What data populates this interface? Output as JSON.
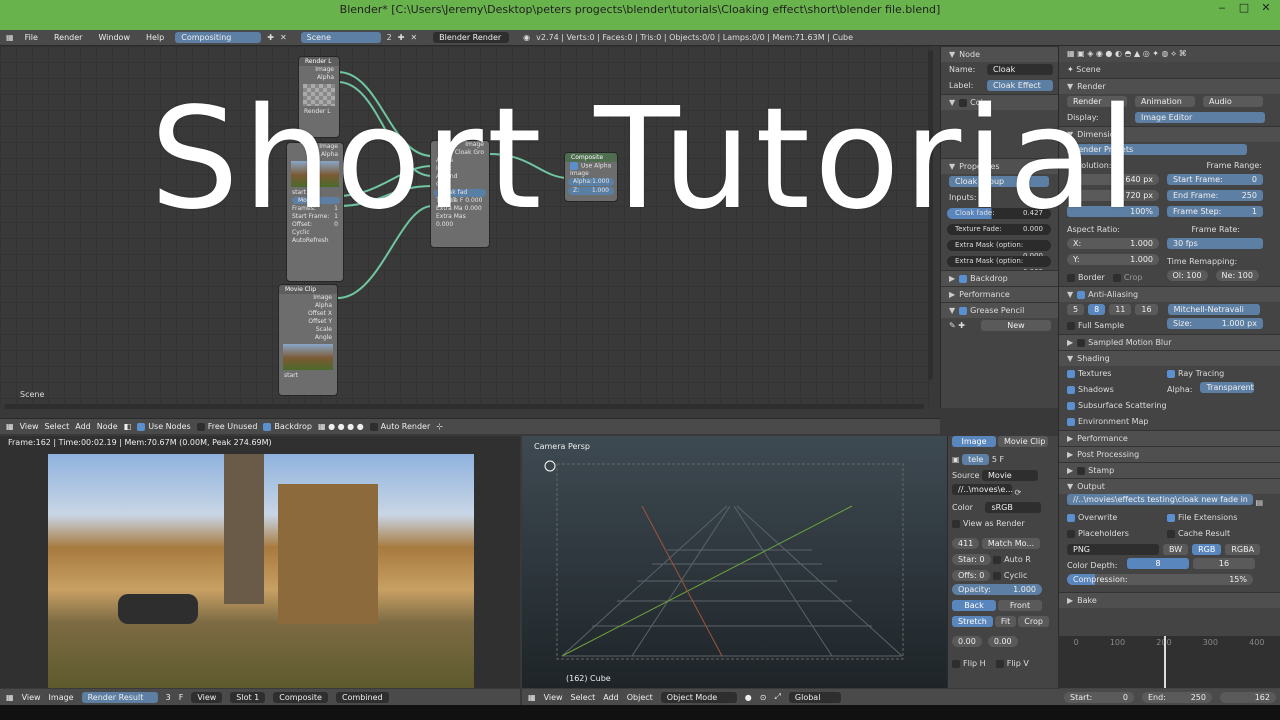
{
  "window": {
    "title": "Blender* [C:\\Users\\Jeremy\\Desktop\\peters progects\\blender\\tutorials\\Cloaking effect\\short\\blender file.blend]",
    "min": "‒",
    "max": "□",
    "close": "✕"
  },
  "topmenu": {
    "items": [
      "File",
      "Render",
      "Window",
      "Help"
    ],
    "layout": "Compositing",
    "scene": "Scene",
    "scene_num": "2",
    "engine": "Blender Render",
    "stats": "v2.74 | Verts:0 | Faces:0 | Tris:0 | Objects:0/0 | Lamps:0/0 | Mem:71.63M | Cube"
  },
  "overlay_text": "Short Tutorial",
  "node_editor": {
    "scene_label": "Scene",
    "nodes": {
      "render_layers": {
        "title": "Render L",
        "rows": [
          "Image",
          "Alpha"
        ],
        "bottom": "Render L"
      },
      "image_node": {
        "rows": [
          "Image",
          "Alpha"
        ],
        "file": "start",
        "num": "2",
        "f": "F",
        "source": "Movie",
        "frames": "Frames:",
        "frames_v": "1",
        "start": "Start Frame:",
        "start_v": "1",
        "offset": "Offset:",
        "offset_v": "0",
        "cyclic": "Cyclic",
        "auto": "AutoRefresh"
      },
      "movie_clip": {
        "title": "Movie Clip",
        "rows": [
          "Image",
          "Alpha",
          "Offset X",
          "Offset Y",
          "Scale",
          "Angle"
        ],
        "file": "start",
        "f": "F"
      },
      "cloak": {
        "rows": [
          "Image",
          "Cloak Gro",
          "Alpha",
          "Input",
          "Around",
          "Clip"
        ],
        "fade": "Cloak fad 0.427",
        "tex": "Texture F 0.000",
        "m1": "Extra Ma 0.000",
        "m2": "Extra Mas 0.000"
      },
      "composite": {
        "title": "Composite",
        "use_alpha": "Use Alpha",
        "rows": [
          "Image"
        ],
        "alpha": "Alpha:",
        "alpha_v": "1.000",
        "z": "Z:",
        "z_v": "1.000"
      }
    },
    "header": {
      "items": [
        "View",
        "Select",
        "Add",
        "Node"
      ],
      "use_nodes": "Use Nodes",
      "free_unused": "Free Unused",
      "backdrop": "Backdrop",
      "auto_render": "Auto Render"
    }
  },
  "n_panel": {
    "node_section": "Node",
    "name_label": "Name:",
    "name_value": "Cloak",
    "label_label": "Label:",
    "label_value": "Cloak Effect",
    "color_section": "Color",
    "properties_section": "Properties",
    "group": "Cloak Group",
    "inputs_label": "Inputs:",
    "inputs": [
      {
        "name": "Cloak fade:",
        "value": "0.427"
      },
      {
        "name": "Texture Fade:",
        "value": "0.000"
      },
      {
        "name": "Extra Mask (option:",
        "value": "0.000"
      },
      {
        "name": "Extra Mask (option:",
        "value": "0.000"
      }
    ],
    "backdrop": "Backdrop",
    "performance": "Performance",
    "grease": "Grease Pencil",
    "new": "New"
  },
  "properties": {
    "scene": "Scene",
    "render_section": "Render",
    "render_btn": "Render",
    "animation_btn": "Animation",
    "audio_btn": "Audio",
    "display_label": "Display:",
    "display_value": "Image Editor",
    "dimensions_section": "Dimensions",
    "render_presets": "Render Presets",
    "resolution": "Resolution:",
    "res_x": "640 px",
    "res_y_label": "Y:",
    "res_y": "720 px",
    "res_pct": "100%",
    "frame_range": "Frame Range:",
    "start_frame": "Start Frame:",
    "start_frame_v": "0",
    "end_frame": "End Frame:",
    "end_frame_v": "250",
    "frame_step": "Frame Step:",
    "frame_step_v": "1",
    "aspect": "Aspect Ratio:",
    "ax": "X:",
    "ax_v": "1.000",
    "ay": "Y:",
    "ay_v": "1.000",
    "frame_rate": "Frame Rate:",
    "fps": "30 fps",
    "time_remap": "Time Remapping:",
    "ol": "Ol: 100",
    "ne": "Ne: 100",
    "border": "Border",
    "crop": "Crop",
    "aa_section": "Anti-Aliasing",
    "aa_samples": [
      "5",
      "8",
      "11",
      "16"
    ],
    "aa_filter": "Mitchell-Netravali",
    "full_sample": "Full Sample",
    "size": "Size:",
    "size_v": "1.000 px",
    "smb_section": "Sampled Motion Blur",
    "shading_section": "Shading",
    "textures": "Textures",
    "ray_tracing": "Ray Tracing",
    "shadows": "Shadows",
    "alpha": "Alpha:",
    "alpha_v": "Transparent",
    "sss": "Subsurface Scattering",
    "env_map": "Environment Map",
    "performance_section": "Performance",
    "post_section": "Post Processing",
    "stamp_section": "Stamp",
    "output_section": "Output",
    "output_path": "//..\\movies\\effects testing\\cloak new fade in",
    "overwrite": "Overwrite",
    "file_ext": "File Extensions",
    "placeholders": "Placeholders",
    "cache_result": "Cache Result",
    "format": "PNG",
    "bw": "BW",
    "rgb": "RGB",
    "rgba": "RGBA",
    "color_depth": "Color Depth:",
    "depth8": "8",
    "depth16": "16",
    "compression": "Compression:",
    "compression_v": "15%",
    "bake_section": "Bake"
  },
  "image_editor": {
    "info": "Frame:162 | Time:00:02.19 | Mem:70.67M (0.00M, Peak 274.69M)",
    "header": [
      "View",
      "Image"
    ],
    "image_name": "Render Result",
    "num": "3",
    "f": "F",
    "view": "View",
    "slot": "Slot 1",
    "composite": "Composite",
    "combined": "Combined"
  },
  "viewport": {
    "label": "Camera Persp",
    "object": "(162) Cube",
    "header": [
      "View",
      "Select",
      "Add",
      "Object"
    ],
    "mode": "Object Mode",
    "global": "Global"
  },
  "clip_panel": {
    "tab_image": "Image",
    "tab_movie": "Movie Clip",
    "name": "tele",
    "num": "5",
    "f": "F",
    "source_label": "Source",
    "source": "Movie",
    "path": "//..\\moves\\e...",
    "color_label": "Color",
    "color": "sRGB",
    "view_as_render": "View as Render",
    "frames": "411",
    "match": "Match Mo...",
    "start": "Star: 0",
    "auto_r": "Auto R",
    "offs": "Offs: 0",
    "cyclic": "Cyclic",
    "opacity": "Opacity:",
    "opacity_v": "1.000",
    "back": "Back",
    "front": "Front",
    "stretch": "Stretch",
    "fit": "Fit",
    "crop": "Crop",
    "v1": "0.00",
    "v2": "0.00",
    "flip_h": "Flip H",
    "flip_v": "Flip V"
  },
  "timeline": {
    "start": "Start:",
    "start_v": "0",
    "end": "End:",
    "end_v": "250",
    "current": "162",
    "ticks": [
      "0",
      "100",
      "200",
      "300",
      "400"
    ]
  }
}
